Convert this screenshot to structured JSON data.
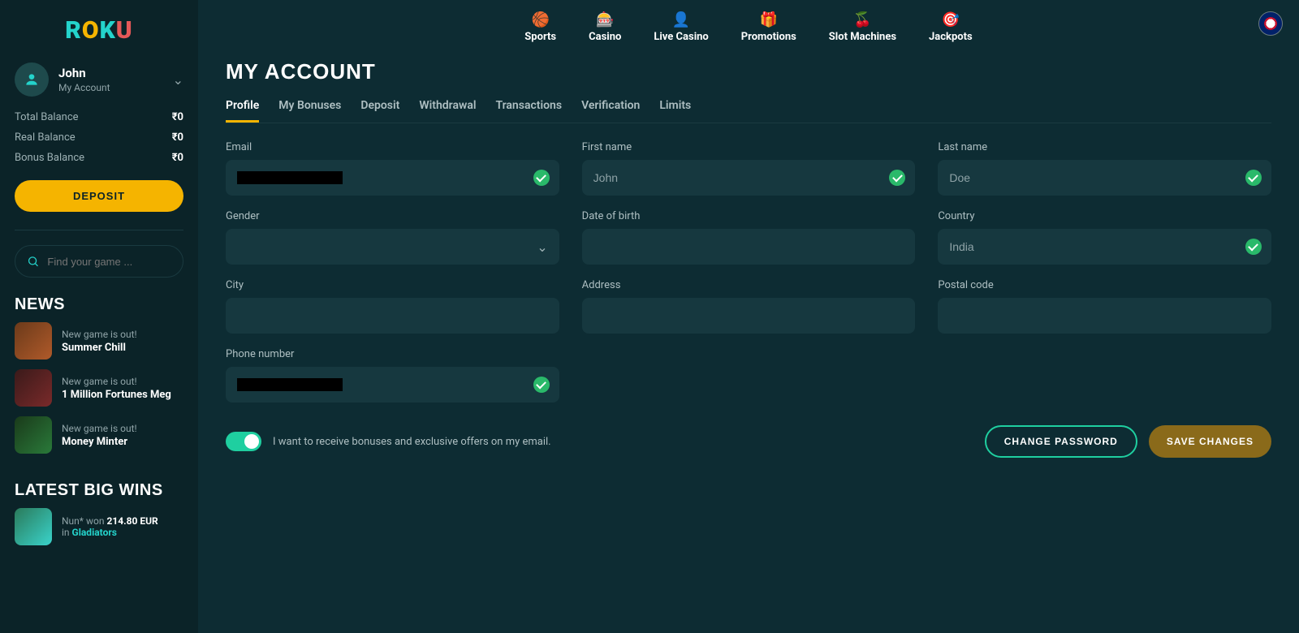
{
  "logo": {
    "l1": "R",
    "l2": "O",
    "l3": "K",
    "l4": "U"
  },
  "user": {
    "name": "John",
    "sub": "My Account"
  },
  "balances": {
    "total": {
      "label": "Total Balance",
      "value": "₹0"
    },
    "real": {
      "label": "Real Balance",
      "value": "₹0"
    },
    "bonus": {
      "label": "Bonus Balance",
      "value": "₹0"
    }
  },
  "depositBtn": "DEPOSIT",
  "search": {
    "placeholder": "Find your game ..."
  },
  "newsTitle": "NEWS",
  "news": [
    {
      "tag": "New game is out!",
      "title": "Summer Chill"
    },
    {
      "tag": "New game is out!",
      "title": "1 Million Fortunes Meg"
    },
    {
      "tag": "New game is out!",
      "title": "Money Minter"
    }
  ],
  "winsTitle": "LATEST BIG WINS",
  "wins": [
    {
      "user": "Nun*",
      "won": "won",
      "amount": "214.80 EUR",
      "in": "in",
      "game": "Gladiators"
    }
  ],
  "nav": [
    {
      "icon": "🏀",
      "label": "Sports"
    },
    {
      "icon": "🎰",
      "label": "Casino"
    },
    {
      "icon": "👤",
      "label": "Live Casino"
    },
    {
      "icon": "🎁",
      "label": "Promotions"
    },
    {
      "icon": "🍒",
      "label": "Slot Machines"
    },
    {
      "icon": "🎯",
      "label": "Jackpots"
    }
  ],
  "pageTitle": "MY ACCOUNT",
  "tabs": [
    "Profile",
    "My Bonuses",
    "Deposit",
    "Withdrawal",
    "Transactions",
    "Verification",
    "Limits"
  ],
  "fields": {
    "email": {
      "label": "Email"
    },
    "firstName": {
      "label": "First name",
      "value": "John"
    },
    "lastName": {
      "label": "Last name",
      "value": "Doe"
    },
    "gender": {
      "label": "Gender"
    },
    "dob": {
      "label": "Date of birth"
    },
    "country": {
      "label": "Country",
      "value": "India"
    },
    "city": {
      "label": "City"
    },
    "address": {
      "label": "Address"
    },
    "postal": {
      "label": "Postal code"
    },
    "phone": {
      "label": "Phone number"
    }
  },
  "toggleLabel": "I want to receive bonuses and exclusive offers on my email.",
  "changePassword": "CHANGE PASSWORD",
  "saveChanges": "SAVE CHANGES"
}
